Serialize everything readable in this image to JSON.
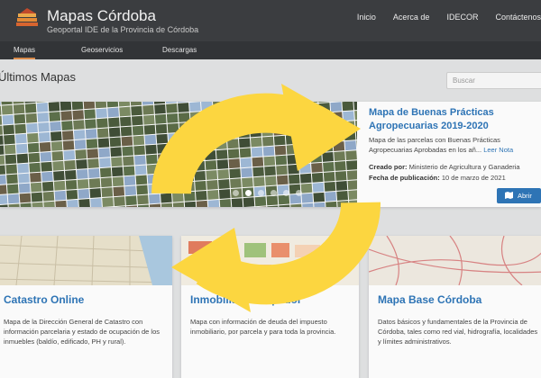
{
  "brand": {
    "title": "Mapas Córdoba",
    "subtitle": "Geoportal IDE de la Provincia de Córdoba",
    "logo_icon": "book-stack-logo"
  },
  "topnav": [
    "Inicio",
    "Acerca de",
    "IDECOR",
    "Contáctenos"
  ],
  "subnav": [
    "Mapas",
    "Geoservicios",
    "Descargas"
  ],
  "section": {
    "title": "Últimos Mapas",
    "search_placeholder": "Buscar"
  },
  "featured": {
    "title": "Mapa de Buenas Prácticas Agropecuarias 2019-2020",
    "description": "Mapa de las parcelas con Buenas Prácticas Agropecuarias Aprobadas en los añ...",
    "more": "Leer Nota",
    "author_label": "Creado por:",
    "author": "Ministerio de Agricultura y Ganaderia",
    "date_label": "Fecha de publicación:",
    "date": "10 de marzo de 2021",
    "open_label": "Abrir",
    "carousel_dots": 6,
    "active_dot": 1
  },
  "cards": [
    {
      "title": "Catastro Online",
      "description": "Mapa de la Dirección General de Catastro con información parcelaria y estado de ocupación de los inmuebles (baldío, edificado, PH y rural)."
    },
    {
      "title": "Inmobiliario Amplidor",
      "description": "Mapa con información de deuda del impuesto inmobiliario, por parcela y para toda la provincia."
    },
    {
      "title": "Mapa Base Córdoba",
      "description": "Datos básicos y fundamentales de la Provincia de Córdoba, tales como red vial, hidrografía, localidades y límites administrativos."
    }
  ],
  "overlay_icon": "refresh-arrows-icon",
  "colors": {
    "header": "#3b3d40",
    "subnav": "#323437",
    "link": "#2e74b5",
    "overlay": "#fcd640",
    "active_tab": "#d98a4a"
  }
}
